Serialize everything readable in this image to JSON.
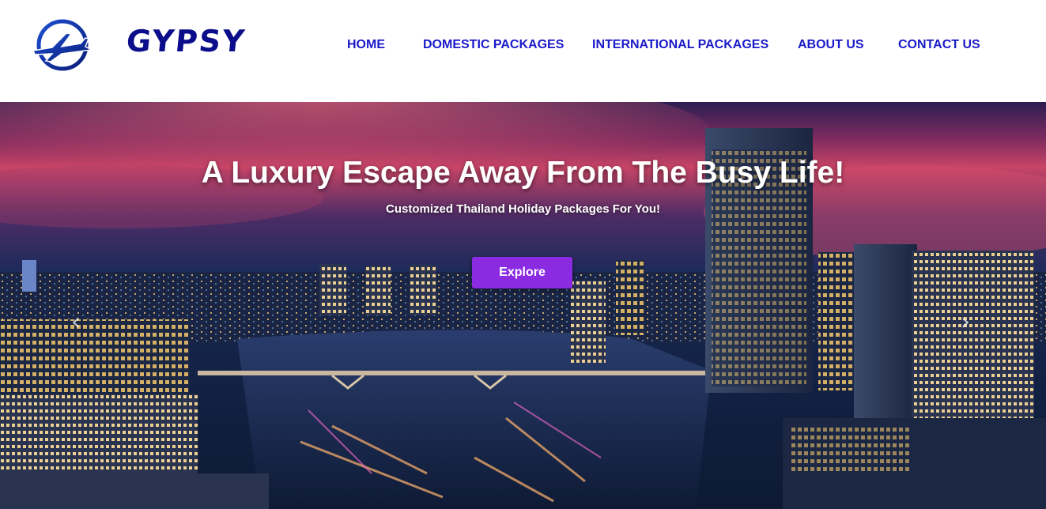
{
  "header": {
    "brand": "GYPSY",
    "logo_icon": "airplane-globe-icon",
    "nav": [
      {
        "label": "HOME"
      },
      {
        "label": "DOMESTIC PACKAGES"
      },
      {
        "label": "INTERNATIONAL PACKAGES"
      },
      {
        "label": "ABOUT US"
      },
      {
        "label": "CONTACT US"
      }
    ]
  },
  "hero": {
    "title": "A Luxury Escape Away From The Busy Life!",
    "subtitle": "Customized Thailand Holiday Packages For You!",
    "cta_label": "Explore",
    "prev_icon": "chevron-left-icon",
    "next_icon": "chevron-right-icon"
  },
  "colors": {
    "brand": "#0b0d8a",
    "nav_link": "#1a1ac9",
    "cta": "#8a2be2"
  }
}
